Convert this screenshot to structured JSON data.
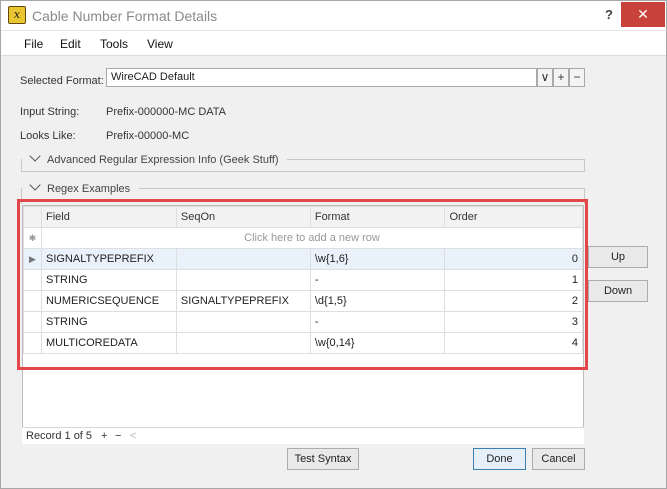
{
  "window": {
    "title": "Cable Number Format Details",
    "help": "?",
    "close": "✕",
    "icon_letter": "x"
  },
  "menu": [
    "File",
    "Edit",
    "Tools",
    "View"
  ],
  "form": {
    "selected_format_label": "Selected Format:",
    "selected_format_value": "WireCAD Default",
    "input_string_label": "Input String:",
    "input_string_value": "Prefix-000000-MC DATA",
    "looks_like_label": "Looks Like:",
    "looks_like_value": "Prefix-00000-MC",
    "dropdown_glyph": "∨",
    "add_glyph": "+",
    "remove_glyph": "−"
  },
  "groups": {
    "advanced": "Advanced Regular Expression Info (Geek Stuff)",
    "examples": "Regex Examples"
  },
  "grid": {
    "columns": [
      "Field",
      "SeqOn",
      "Format",
      "Order"
    ],
    "new_row_text": "Click here to add a new row",
    "new_row_glyph": "✱",
    "selected_glyph": "▶",
    "rows": [
      {
        "field": "SIGNALTYPEPREFIX",
        "seqon": "",
        "format": "\\w{1,6}",
        "order": "0"
      },
      {
        "field": "STRING",
        "seqon": "",
        "format": "-",
        "order": "1"
      },
      {
        "field": "NUMERICSEQUENCE",
        "seqon": "SIGNALTYPEPREFIX",
        "format": "\\d{1,5}",
        "order": "2"
      },
      {
        "field": "STRING",
        "seqon": "",
        "format": "-",
        "order": "3"
      },
      {
        "field": "MULTICOREDATA",
        "seqon": "",
        "format": "\\w{0,14}",
        "order": "4"
      }
    ]
  },
  "navigator": {
    "record": "Record 1 of 5",
    "add": "+",
    "remove": "−",
    "left": "<"
  },
  "buttons": {
    "up": "Up",
    "down": "Down",
    "test_syntax": "Test Syntax",
    "done": "Done",
    "cancel": "Cancel"
  }
}
